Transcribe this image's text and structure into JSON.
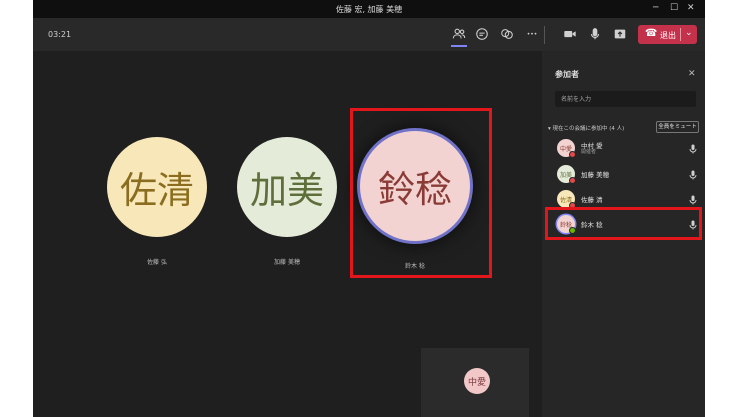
{
  "window": {
    "title": "佐藤 宏, 加藤 美穂",
    "minimize_glyph": "─",
    "maximize_glyph": "☐",
    "close_glyph": "✕"
  },
  "toolbar": {
    "timer": "03:21",
    "icons": [
      "people-icon",
      "chat-icon",
      "reactions-icon",
      "more-icon",
      "camera-icon",
      "mic-icon",
      "share-icon"
    ],
    "more_glyph": "•••",
    "leave": {
      "phone_glyph": "☎",
      "label": "退出",
      "chevron": "⌄"
    },
    "accent": "#c4314b"
  },
  "stage": {
    "tiles": [
      {
        "initials": "佐清",
        "name": "佐藤 弘",
        "bg": "#f7e7b9",
        "fg": "#8a6d1f"
      },
      {
        "initials": "加美",
        "name": "加藤 美穂",
        "bg": "#e4ecd9",
        "fg": "#5f6f3b"
      },
      {
        "initials": "鈴稔",
        "name": "鈴木 稔",
        "bg": "#f2d3d1",
        "fg": "#8a3b36",
        "speaking": true
      }
    ],
    "self_view": {
      "initials": "中愛"
    },
    "highlight_color": "#e3161c"
  },
  "panel": {
    "title": "参加者",
    "close_glyph": "✕",
    "search_placeholder": "名前を入力",
    "section_label": "▾ 現在この会議に参加中 (4 人)",
    "mute_all": "全員をミュート",
    "participants": [
      {
        "name": "中村 愛",
        "role": "開催者",
        "initials": "中愛",
        "bg": "#f2d3d1",
        "fg": "#8a3b36",
        "status": "#e24a4a"
      },
      {
        "name": "加藤 美穂",
        "initials": "加美",
        "bg": "#e4ecd9",
        "fg": "#5f6f3b",
        "status": "#e24a4a"
      },
      {
        "name": "佐藤 清",
        "initials": "佐清",
        "bg": "#f7e7b9",
        "fg": "#8a6d1f",
        "status": "#e24a4a"
      },
      {
        "name": "鈴木 稔",
        "initials": "鈴稔",
        "bg": "#f2d3d1",
        "fg": "#8a3b36",
        "status": "#6bb700"
      }
    ]
  }
}
